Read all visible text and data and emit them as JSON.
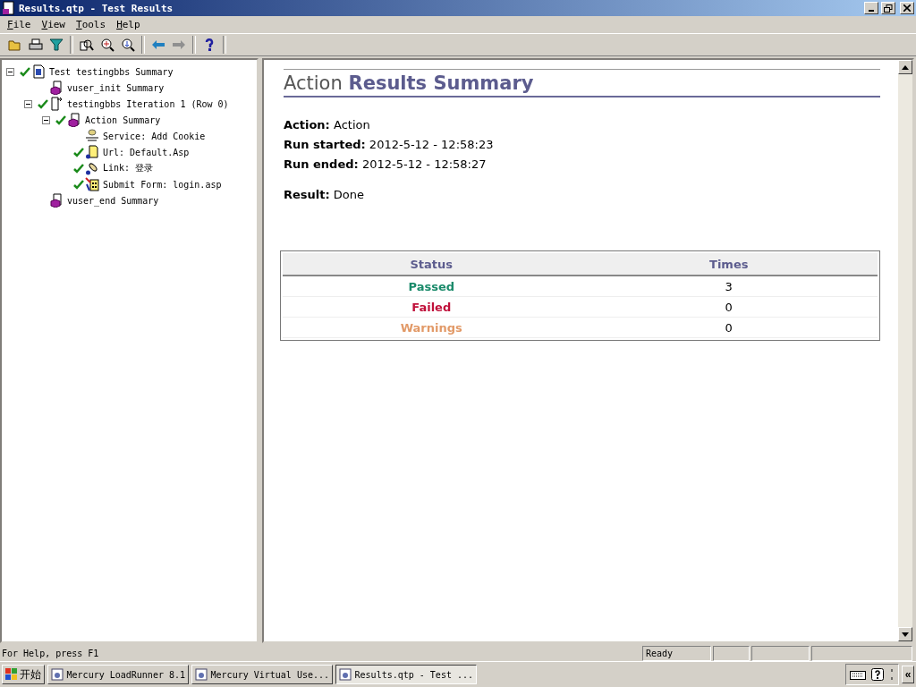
{
  "window": {
    "title": "Results.qtp - Test Results"
  },
  "menu": [
    "File",
    "View",
    "Tools",
    "Help"
  ],
  "tree": [
    {
      "label": "Test testingbbs Summary",
      "kind": "test",
      "checked": true,
      "expanded": true,
      "children": [
        {
          "label": "vuser_init Summary",
          "kind": "action",
          "checked": false
        },
        {
          "label": "testingbbs Iteration 1 (Row 0)",
          "kind": "iteration",
          "checked": true,
          "expanded": true,
          "children": [
            {
              "label": "Action Summary",
              "kind": "action",
              "checked": true,
              "expanded": true,
              "children": [
                {
                  "label": "Service: Add Cookie",
                  "kind": "service",
                  "checked": false
                },
                {
                  "label": "Url: Default.Asp",
                  "kind": "url",
                  "checked": true
                },
                {
                  "label": "Link: 登录",
                  "kind": "link",
                  "checked": true
                },
                {
                  "label": "Submit Form: login.asp",
                  "kind": "form",
                  "checked": true
                }
              ]
            }
          ]
        },
        {
          "label": "vuser_end Summary",
          "kind": "action",
          "checked": false
        }
      ]
    }
  ],
  "summary": {
    "title_light": "Action",
    "title_bold": "Results Summary",
    "fields": [
      {
        "label": "Action:",
        "value": "Action"
      },
      {
        "label": "Run started:",
        "value": "2012-5-12 - 12:58:23"
      },
      {
        "label": "Run ended:",
        "value": "2012-5-12 - 12:58:27"
      }
    ],
    "result": {
      "label": "Result:",
      "value": "Done"
    }
  },
  "table": {
    "columns": [
      "Status",
      "Times"
    ],
    "rows": [
      {
        "status": "Passed",
        "color": "#1a8a6a",
        "times": "3"
      },
      {
        "status": "Failed",
        "color": "#c0103a",
        "times": "0"
      },
      {
        "status": "Warnings",
        "color": "#e29a68",
        "times": "0"
      }
    ]
  },
  "status_bar": {
    "help": "For Help, press F1",
    "state": "Ready"
  },
  "taskbar": {
    "start": "开始",
    "tasks": [
      {
        "label": "Mercury LoadRunner 8.1",
        "selected": false
      },
      {
        "label": "Mercury Virtual Use...",
        "selected": false
      },
      {
        "label": "Results.qtp - Test ...",
        "selected": true
      }
    ],
    "tray_toggle": "«"
  }
}
